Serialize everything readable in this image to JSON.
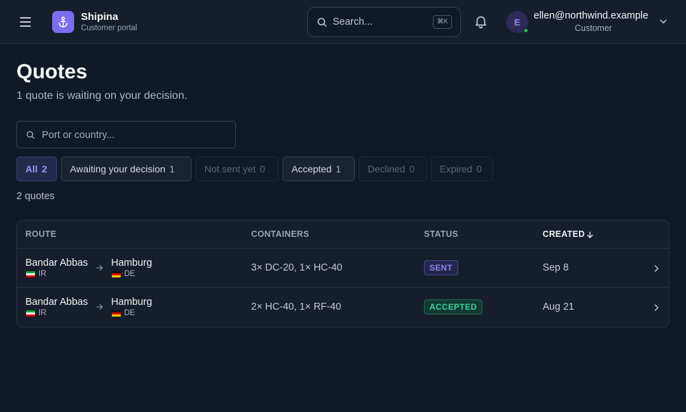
{
  "app": {
    "name": "Shipina",
    "subtitle": "Customer portal"
  },
  "header": {
    "search_placeholder": "Search...",
    "search_shortcut": "⌘K",
    "user": {
      "initial": "E",
      "email": "ellen@northwind.example",
      "role": "Customer",
      "status": "online"
    }
  },
  "page": {
    "title": "Quotes",
    "subtitle": "1 quote is waiting on your decision.",
    "filter_placeholder": "Port or country...",
    "result_count": "2 quotes"
  },
  "filters": [
    {
      "label": "All",
      "count": "2",
      "state": "active"
    },
    {
      "label": "Awaiting your decision",
      "count": "1",
      "state": "normal"
    },
    {
      "label": "Not sent yet",
      "count": "0",
      "state": "disabled"
    },
    {
      "label": "Accepted",
      "count": "1",
      "state": "normal"
    },
    {
      "label": "Declined",
      "count": "0",
      "state": "disabled"
    },
    {
      "label": "Expired",
      "count": "0",
      "state": "disabled"
    }
  ],
  "table": {
    "columns": {
      "route": "ROUTE",
      "containers": "CONTAINERS",
      "status": "STATUS",
      "created": "CREATED"
    },
    "sort": {
      "column": "created",
      "direction": "desc"
    },
    "rows": [
      {
        "origin": "Bandar Abbas",
        "origin_country": "IR",
        "destination": "Hamburg",
        "destination_country": "DE",
        "containers": "3× DC-20, 1× HC-40",
        "status": "SENT",
        "created": "Sep 8"
      },
      {
        "origin": "Bandar Abbas",
        "origin_country": "IR",
        "destination": "Hamburg",
        "destination_country": "DE",
        "containers": "2× HC-40, 1× RF-40",
        "status": "ACCEPTED",
        "created": "Aug 21"
      }
    ]
  },
  "colors": {
    "background": "#111827",
    "surface": "#161d2b",
    "accent": "#7c6cf0",
    "status_sent": "#8f86f4",
    "status_accepted": "#37d399",
    "online": "#22c55e"
  },
  "icons": [
    "menu-icon",
    "anchor-icon",
    "search-icon",
    "bell-icon",
    "chevron-down-icon",
    "arrow-right-icon",
    "arrow-down-icon",
    "chevron-right-icon"
  ]
}
